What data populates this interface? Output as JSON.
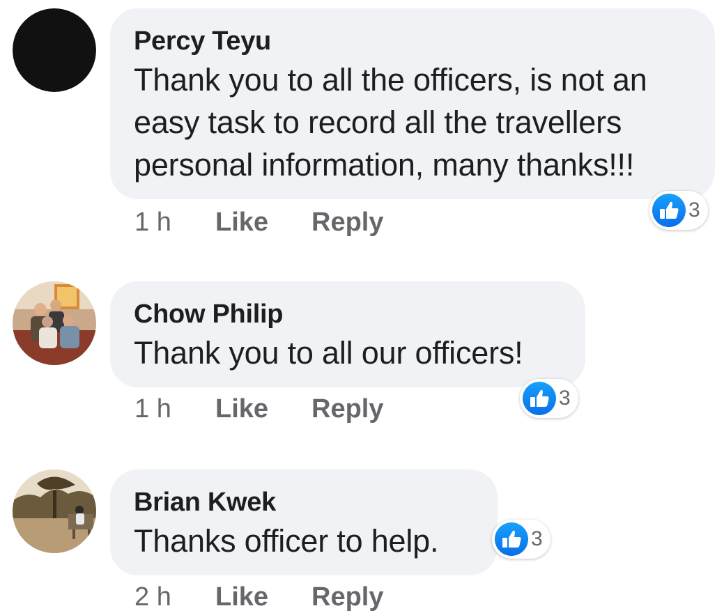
{
  "comments": [
    {
      "author": "Percy Teyu",
      "text_lines": [
        "Thank you to all the officers, is not an",
        "easy task to record all the travellers",
        "personal information, many thanks!!!"
      ],
      "time": "1 h",
      "like_label": "Like",
      "reply_label": "Reply",
      "reaction_count": "3",
      "avatar_icon": "dark-circle-avatar"
    },
    {
      "author": "Chow Philip",
      "text_lines": [
        "Thank you to all our officers!"
      ],
      "time": "1 h",
      "like_label": "Like",
      "reply_label": "Reply",
      "reaction_count": "3",
      "avatar_icon": "group-photo-avatar"
    },
    {
      "author": "Brian Kwek",
      "text_lines": [
        "Thanks officer to help."
      ],
      "time": "2 h",
      "like_label": "Like",
      "reply_label": "Reply",
      "reaction_count": "3",
      "avatar_icon": "landscape-photo-avatar"
    }
  ],
  "colors": {
    "bubble": "#f0f2f5",
    "text": "#1c1e21",
    "meta": "#65676b",
    "like_blue": "#1877f2"
  }
}
